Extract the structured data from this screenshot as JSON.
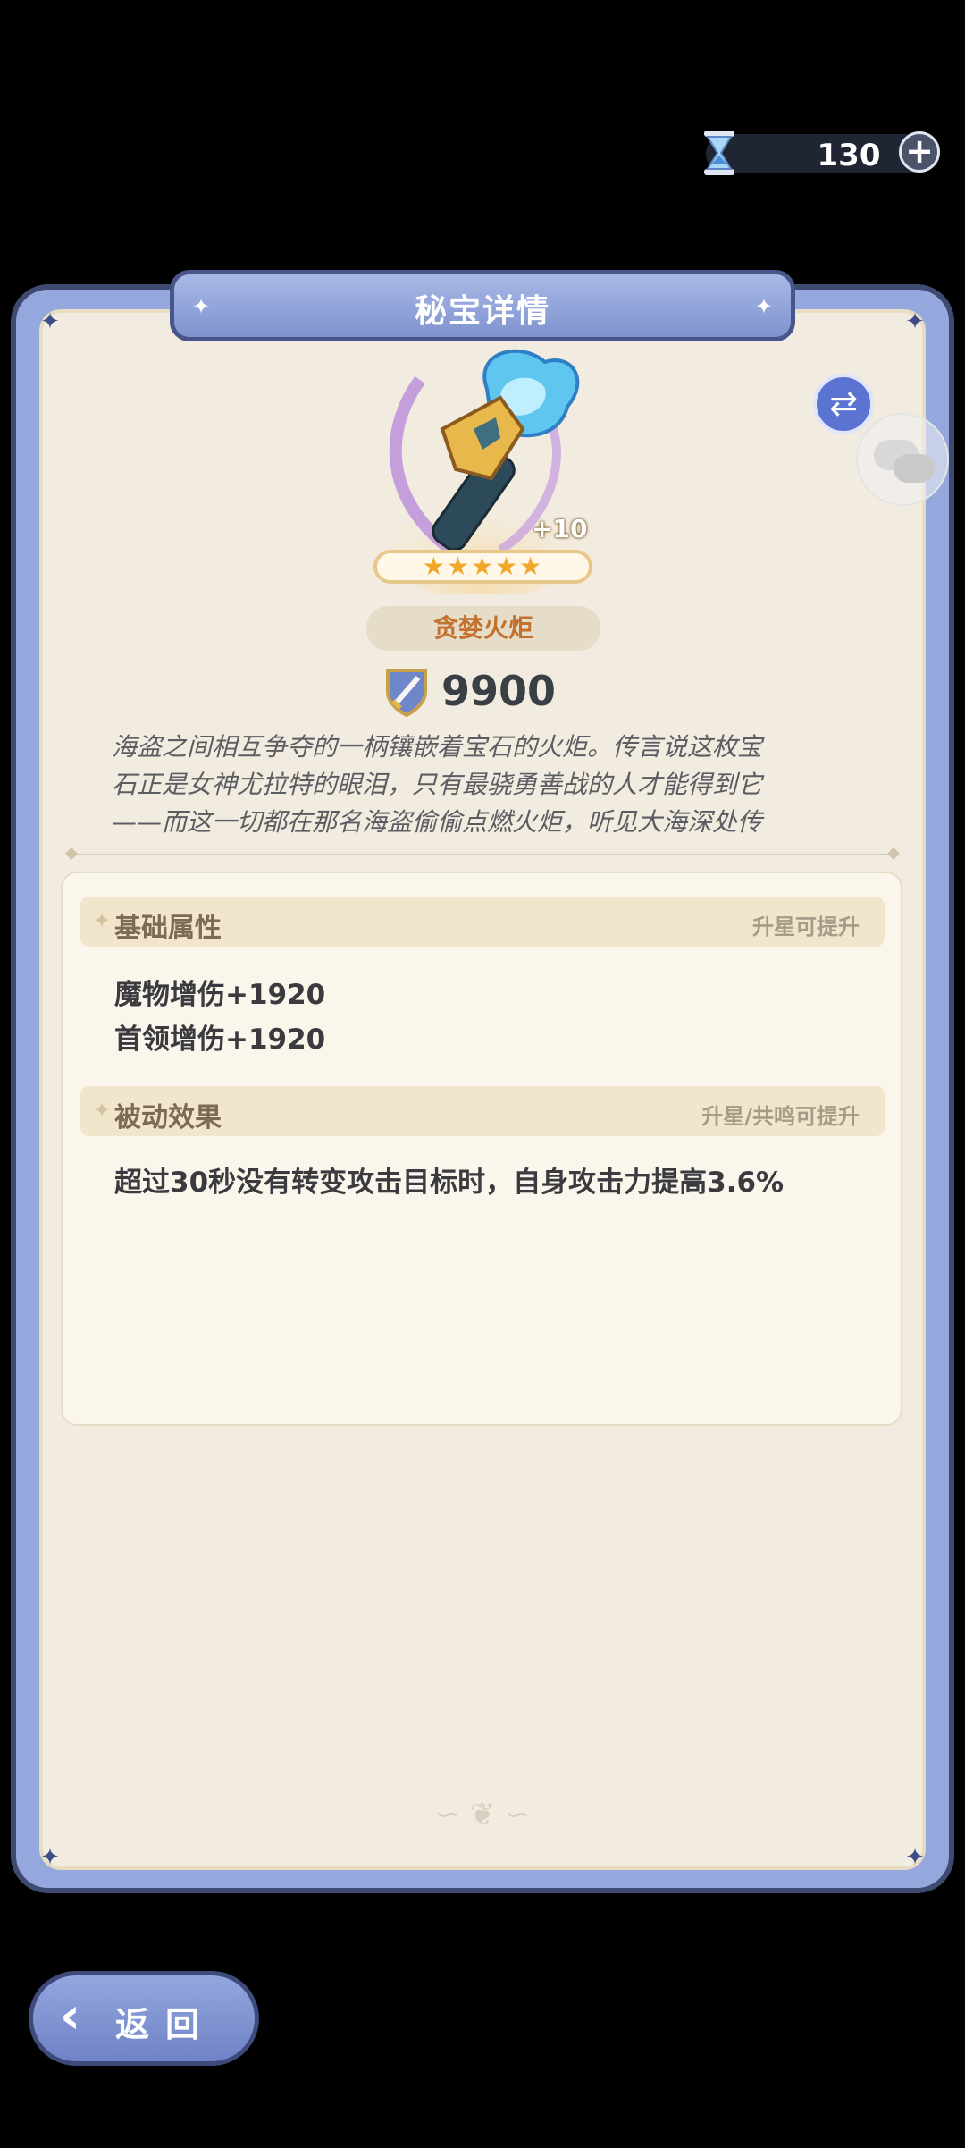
{
  "currency": {
    "amount": "130",
    "add_icon": "plus-icon",
    "icon": "hourglass-icon"
  },
  "panel": {
    "title": "秘宝详情"
  },
  "item": {
    "level": "+10",
    "stars": "★★★★★",
    "name": "贪婪火炬",
    "power": "9900",
    "description": "海盗之间相互争夺的一柄镶嵌着宝石的火炬。传言说这枚宝\n石正是女神尤拉特的眼泪，只有最骁勇善战的人才能得到它\n——而这一切都在那名海盗偷偷点燃火炬，听见大海深处传"
  },
  "sections": {
    "basic": {
      "title": "基础属性",
      "hint": "升星可提升",
      "lines": [
        "魔物增伤+1920",
        "首领增伤+1920"
      ]
    },
    "passive": {
      "title": "被动效果",
      "hint": "升星/共鸣可提升",
      "lines": [
        "超过30秒没有转变攻击目标时，自身攻击力提高3.6%"
      ]
    }
  },
  "buttons": {
    "back_label": "返回",
    "swap_icon": "swap-arrows-icon",
    "chat_icon": "chat-bubbles-icon"
  },
  "colors": {
    "panel_frame": "#95a8dd",
    "parchment": "#f2ece0",
    "name_text": "#c2722e",
    "accent_blue": "#5b74d2"
  }
}
